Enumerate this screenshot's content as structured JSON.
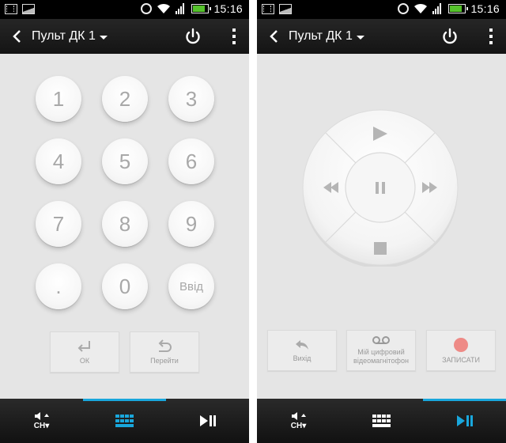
{
  "status_bar": {
    "time": "15:16"
  },
  "action_bar": {
    "title": "Пульт ДК 1"
  },
  "keypad": {
    "keys": [
      "1",
      "2",
      "3",
      "4",
      "5",
      "6",
      "7",
      "8",
      "9",
      ".",
      "0",
      "Ввід"
    ]
  },
  "left_actions": {
    "ok_label": "ОК",
    "go_label": "Перейти"
  },
  "right_actions": {
    "exit_label": "Вихід",
    "dvr_label": "Мій цифровий відеомагнітофон",
    "record_label": "ЗАПИСАТИ"
  },
  "bottom_bar": {
    "tabs": [
      {
        "icon": "volume-channel-icon",
        "label": "CH"
      },
      {
        "icon": "keypad-grid-icon"
      },
      {
        "icon": "play-pause-icon"
      }
    ],
    "active_left": 1,
    "active_right": 2
  },
  "colors": {
    "accent": "#19a7dc",
    "record": "#ee8a86",
    "battery": "#55c22b",
    "background": "#e5e5e5",
    "key_text": "#a8a8a8"
  }
}
